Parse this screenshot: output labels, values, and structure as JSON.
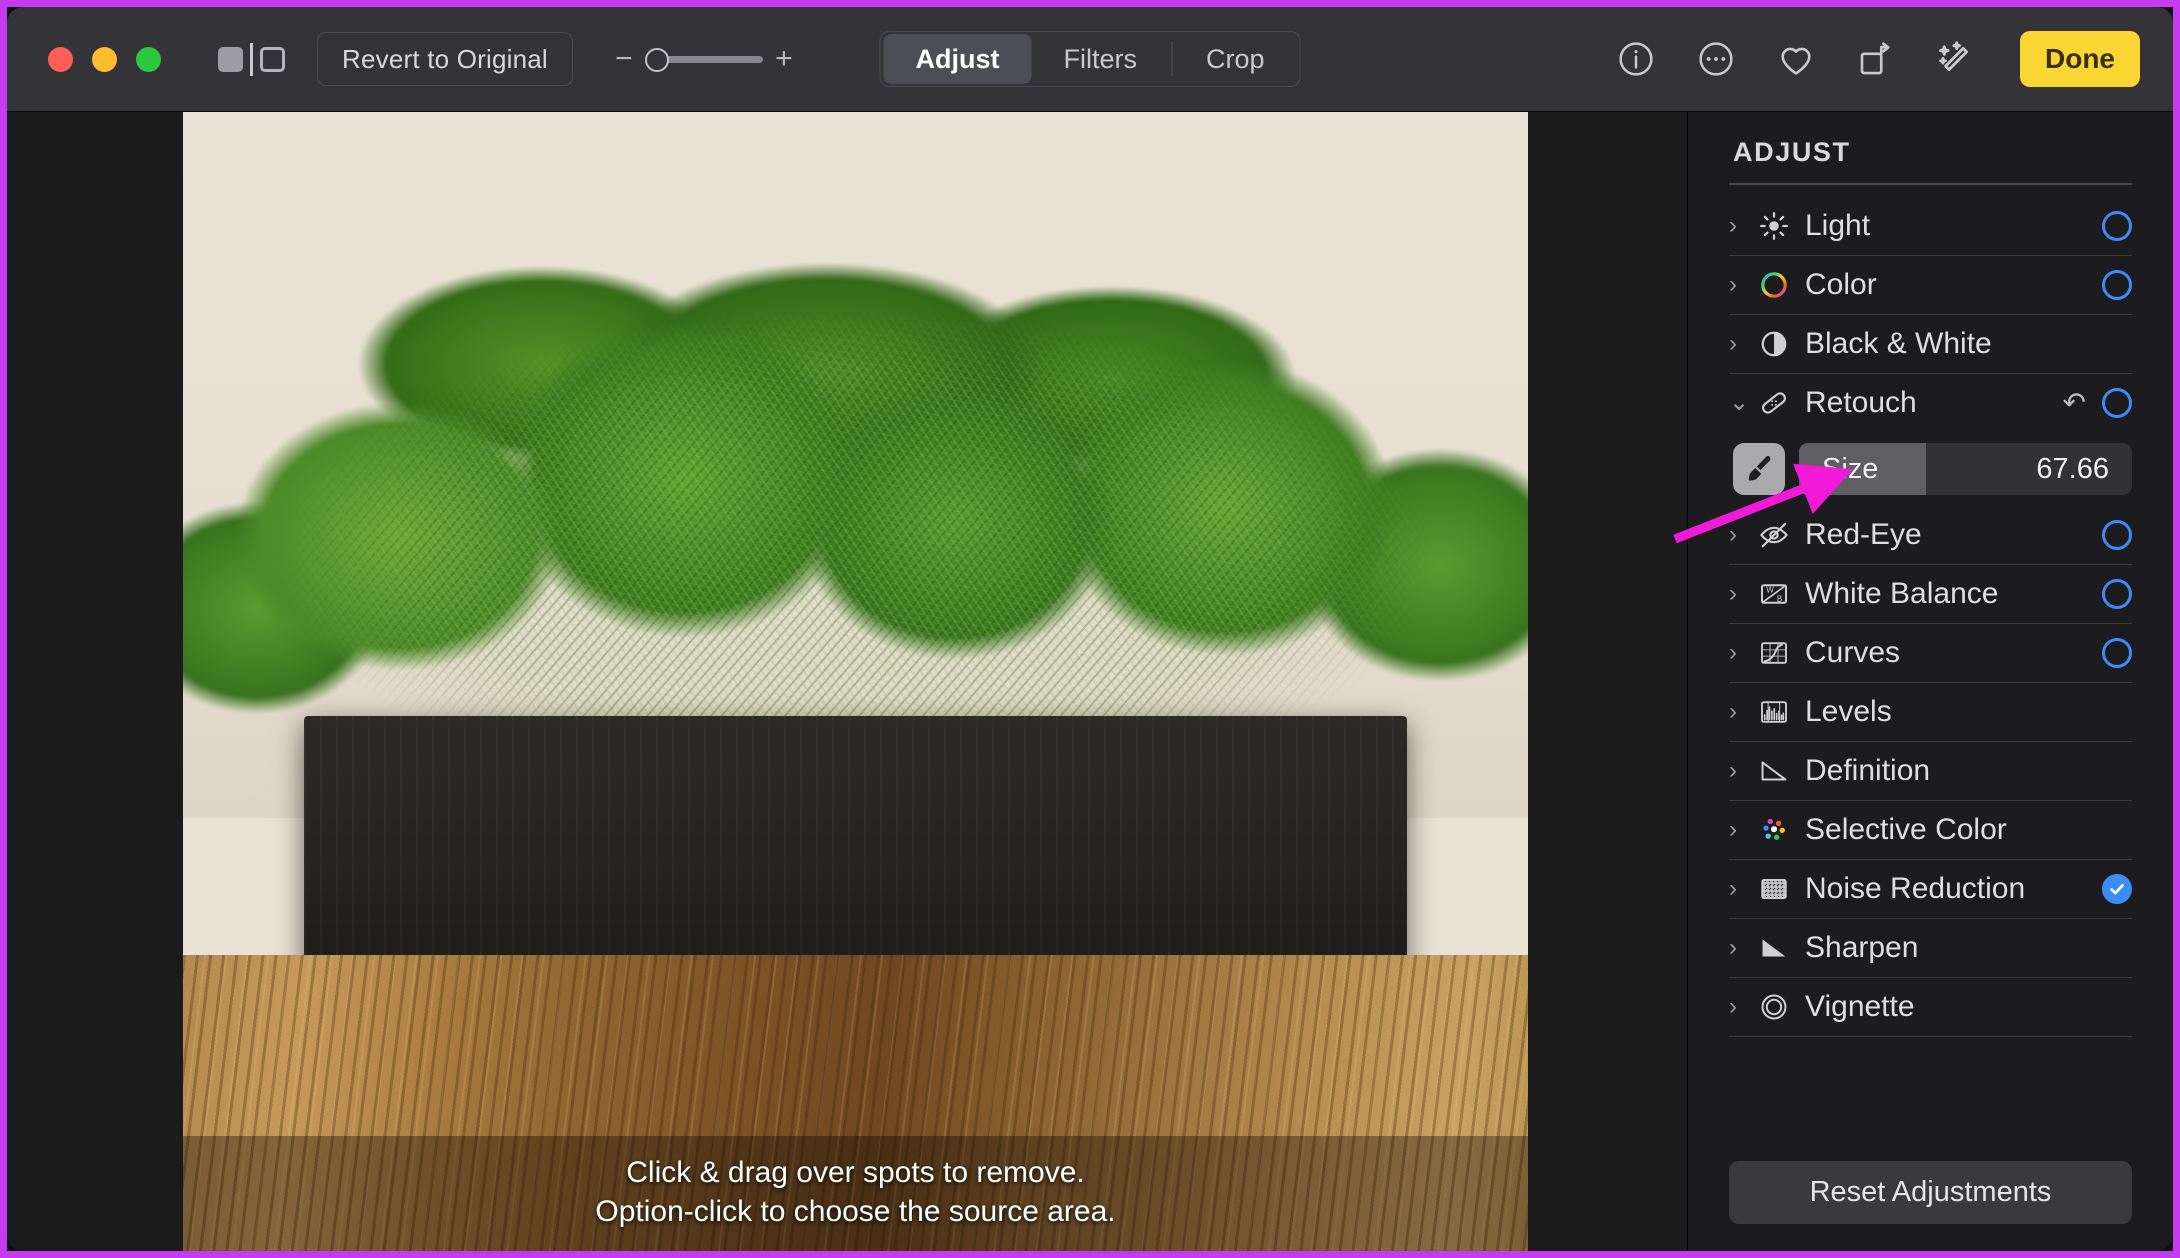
{
  "window": {
    "traffic_lights": [
      {
        "name": "close",
        "color": "#ff5f57"
      },
      {
        "name": "minimize",
        "color": "#febc2e"
      },
      {
        "name": "maximize",
        "color": "#2bc840"
      }
    ]
  },
  "toolbar": {
    "split_view_label": "split-view-toggle",
    "revert_label": "Revert to Original",
    "zoom": {
      "minus": "−",
      "plus": "+",
      "value": 0
    },
    "tabs": [
      {
        "label": "Adjust",
        "active": true
      },
      {
        "label": "Filters",
        "active": false
      },
      {
        "label": "Crop",
        "active": false
      }
    ],
    "icons": [
      {
        "name": "info-icon"
      },
      {
        "name": "more-options-icon"
      },
      {
        "name": "favorite-heart-icon"
      },
      {
        "name": "rotate-icon"
      },
      {
        "name": "auto-enhance-icon"
      }
    ],
    "done_label": "Done"
  },
  "canvas": {
    "caption_line1": "Click & drag over spots to remove.",
    "caption_line2": "Option-click to choose the source area."
  },
  "sidebar": {
    "title": "ADJUST",
    "reset_label": "Reset Adjustments",
    "items": [
      {
        "label": "Light",
        "icon": "brightness-sun-icon",
        "expanded": false,
        "indicator": "ring",
        "undo": false
      },
      {
        "label": "Color",
        "icon": "color-wheel-icon",
        "expanded": false,
        "indicator": "ring",
        "undo": false
      },
      {
        "label": "Black & White",
        "icon": "black-white-icon",
        "expanded": false,
        "indicator": "none",
        "undo": false
      },
      {
        "label": "Retouch",
        "icon": "bandage-retouch-icon",
        "expanded": true,
        "indicator": "ring",
        "undo": true
      },
      {
        "label": "Red-Eye",
        "icon": "red-eye-icon",
        "expanded": false,
        "indicator": "ring",
        "undo": false
      },
      {
        "label": "White Balance",
        "icon": "white-balance-icon",
        "expanded": false,
        "indicator": "ring",
        "undo": false
      },
      {
        "label": "Curves",
        "icon": "curves-icon",
        "expanded": false,
        "indicator": "ring",
        "undo": false
      },
      {
        "label": "Levels",
        "icon": "levels-icon",
        "expanded": false,
        "indicator": "none",
        "undo": false
      },
      {
        "label": "Definition",
        "icon": "definition-icon",
        "expanded": false,
        "indicator": "none",
        "undo": false
      },
      {
        "label": "Selective Color",
        "icon": "selective-color-icon",
        "expanded": false,
        "indicator": "none",
        "undo": false
      },
      {
        "label": "Noise Reduction",
        "icon": "noise-reduction-icon",
        "expanded": false,
        "indicator": "checked",
        "undo": false
      },
      {
        "label": "Sharpen",
        "icon": "sharpen-icon",
        "expanded": false,
        "indicator": "none",
        "undo": false
      },
      {
        "label": "Vignette",
        "icon": "vignette-icon",
        "expanded": false,
        "indicator": "none",
        "undo": false
      }
    ],
    "retouch": {
      "brush_icon": "brush-icon",
      "size_label": "Size",
      "size_value": "67.66",
      "size_fill_percent": 38
    }
  },
  "annotation": {
    "frame_color": "#c43bf0",
    "arrow_color": "#f01ad8",
    "arrow_target": "size-slider"
  },
  "colors": {
    "accent_yellow": "#fbd531",
    "accent_blue": "#3c8cf5",
    "toolbar_bg": "#333338",
    "sidebar_bg": "#1c1c1e"
  }
}
